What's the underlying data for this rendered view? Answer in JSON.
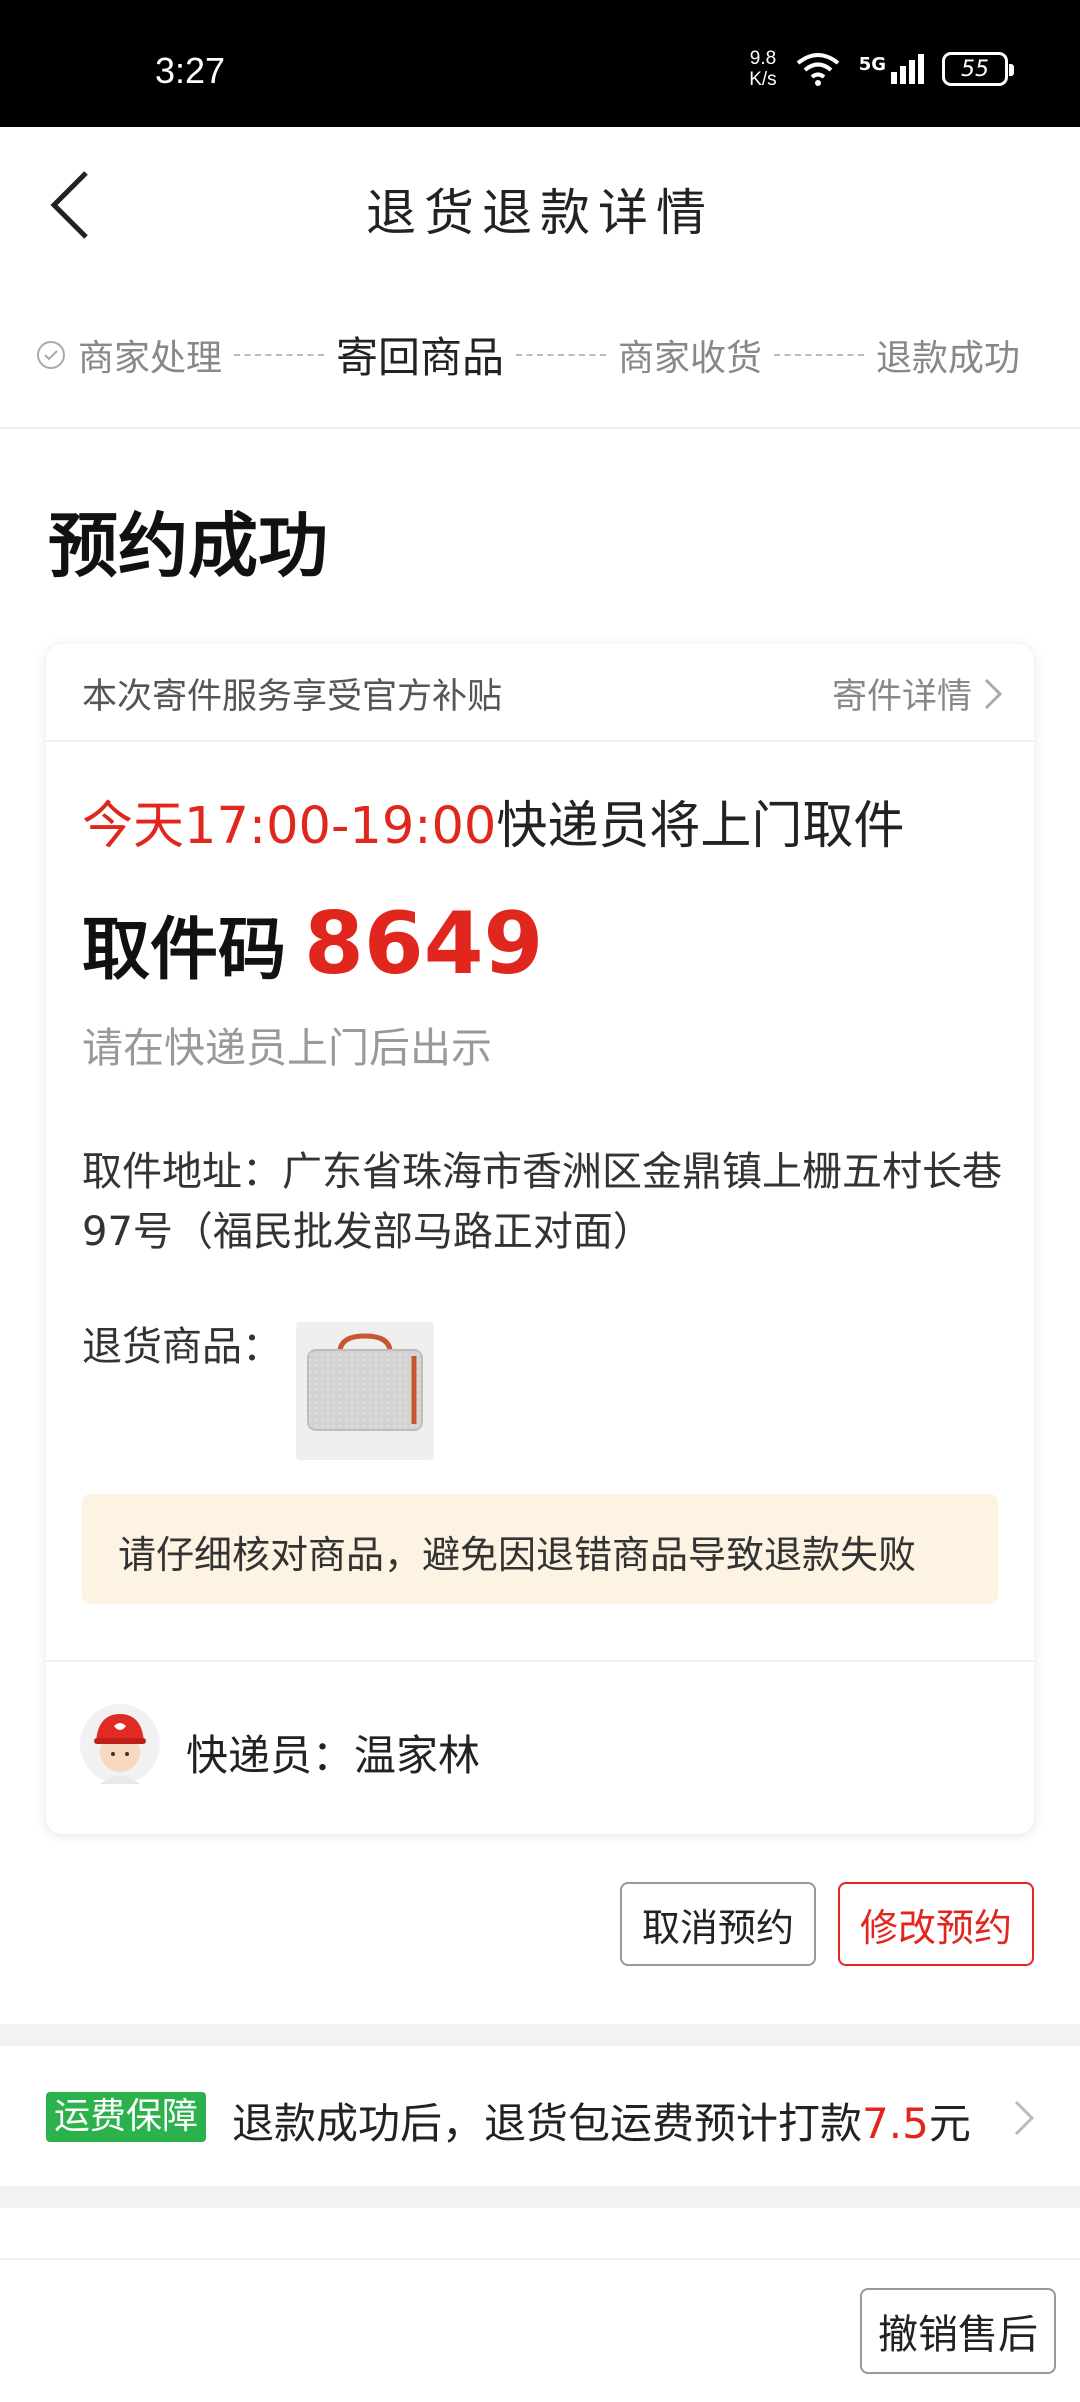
{
  "status_bar": {
    "time": "3:27",
    "net_speed_value": "9.8",
    "net_speed_unit": "K/s",
    "network": "5G",
    "battery": "55"
  },
  "nav": {
    "title": "退货退款详情"
  },
  "steps": [
    {
      "label": "商家处理",
      "state": "done"
    },
    {
      "label": "寄回商品",
      "state": "active"
    },
    {
      "label": "商家收货",
      "state": "pending"
    },
    {
      "label": "退款成功",
      "state": "pending"
    }
  ],
  "status_title": "预约成功",
  "card": {
    "subsidy_text": "本次寄件服务享受官方补贴",
    "detail_link": "寄件详情",
    "pickup_time": "今天17:00-19:00",
    "pickup_suffix": "快递员将上门取件",
    "code_label": "取件码",
    "code_value": "8649",
    "code_hint": "请在快递员上门后出示",
    "address": "取件地址：广东省珠海市香洲区金鼎镇上栅五村长巷97号（福民批发部马路正对面）",
    "goods_label": "退货商品：",
    "notice": "请仔细核对商品，避免因退错商品导致退款失败",
    "courier": "快递员：温家林"
  },
  "actions": {
    "cancel_label": "取消预约",
    "modify_label": "修改预约"
  },
  "freight": {
    "badge": "运费保障",
    "text_prefix": "退款成功后，退货包运费预计打款",
    "amount": "7.5",
    "unit": "元"
  },
  "bottom": {
    "revoke_label": "撤销售后"
  },
  "colors": {
    "accent_red": "#e0261d",
    "badge_green": "#2bb24c",
    "notice_bg": "#fdf3e3"
  }
}
